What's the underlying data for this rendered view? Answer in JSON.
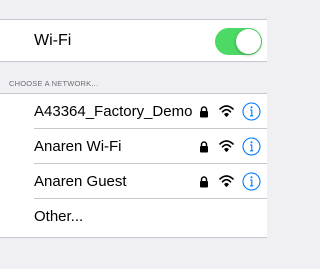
{
  "wifi": {
    "label": "Wi-Fi",
    "enabled": true,
    "toggle_color": "#4cd964"
  },
  "networks_section": {
    "header": "CHOOSE A NETWORK...",
    "networks": [
      {
        "name": "A43364_Factory_Demo",
        "secured": true,
        "icons": [
          "lock-icon",
          "wifi-signal-icon",
          "info-icon"
        ]
      },
      {
        "name": "Anaren Wi-Fi",
        "secured": true,
        "icons": [
          "lock-icon",
          "wifi-signal-icon",
          "info-icon"
        ]
      },
      {
        "name": "Anaren Guest",
        "secured": true,
        "icons": [
          "lock-icon",
          "wifi-signal-icon",
          "info-icon"
        ]
      }
    ],
    "other_label": "Other..."
  },
  "colors": {
    "accent": "#007aff",
    "background": "#efeff4",
    "separator": "#c8c7cc",
    "header_text": "#6d6d72"
  }
}
